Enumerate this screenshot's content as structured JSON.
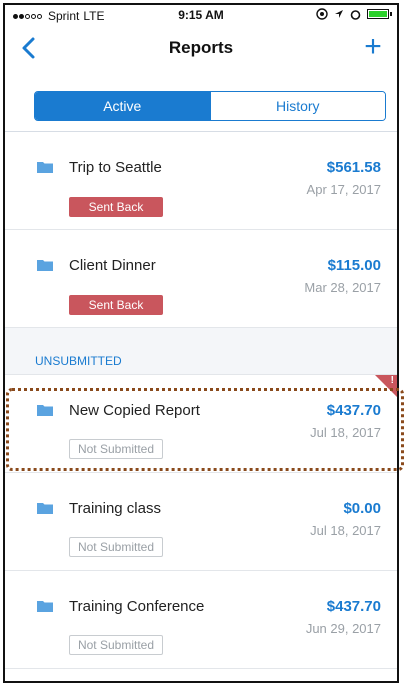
{
  "status_bar": {
    "carrier": "Sprint",
    "network": "LTE",
    "time": "9:15 AM"
  },
  "nav": {
    "title": "Reports",
    "back_icon": "chevron-left-icon",
    "add_icon": "plus-icon",
    "add_label": "+"
  },
  "segments": {
    "active": "Active",
    "history": "History"
  },
  "sections": {
    "unsubmitted": "UNSUBMITTED"
  },
  "reports": [
    {
      "title": "Trip to Seattle",
      "amount": "$561.58",
      "date": "Apr 17, 2017",
      "status": "Sent Back"
    },
    {
      "title": "Client Dinner",
      "amount": "$115.00",
      "date": "Mar 28, 2017",
      "status": "Sent Back"
    },
    {
      "title": "New Copied Report",
      "amount": "$437.70",
      "date": "Jul 18, 2017",
      "status": "Not Submitted",
      "flag": "!"
    },
    {
      "title": "Training class",
      "amount": "$0.00",
      "date": "Jul 18, 2017",
      "status": "Not Submitted"
    },
    {
      "title": "Training Conference",
      "amount": "$437.70",
      "date": "Jun 29, 2017",
      "status": "Not Submitted"
    }
  ],
  "colors": {
    "accent": "#1a7bd0",
    "sent_back": "#c9565d",
    "highlight": "#8a4a1c"
  }
}
